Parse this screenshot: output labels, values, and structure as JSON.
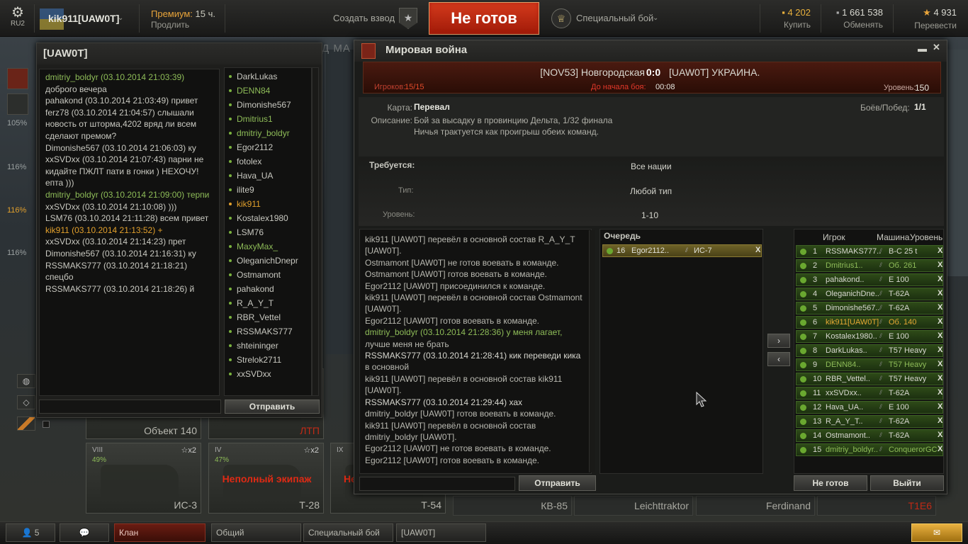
{
  "topbar": {
    "server": "RU2",
    "player_name": "kik911[UAW0T]",
    "premium_label": "Премиум:",
    "premium_days": "15 ч.",
    "extend": "Продлить",
    "create_platoon": "Создать взвод",
    "ready_button": "Не готов",
    "battle_mode": "Специальный бой",
    "gold": {
      "value": "4 202",
      "label": "Купить"
    },
    "credits": {
      "value": "1 661 538",
      "label": "Обменять"
    },
    "free_exp": {
      "value": "4 931",
      "label": "Перевести"
    }
  },
  "side": {
    "pct1": "105%",
    "pct2": "116%",
    "pct3": "116%",
    "pct4": "116%"
  },
  "hangar_tabs": "АНГАР  СКЛАД  МА",
  "chat": {
    "title": "[UAW0T]",
    "send": "Отправить",
    "messages": [
      {
        "t": "dmitriy_boldyr (03.10.2014 21:03:39)",
        "c": "green"
      },
      {
        "t": "доброго вечера",
        "c": ""
      },
      {
        "t": "pahakond (03.10.2014 21:03:49) привет",
        "c": ""
      },
      {
        "t": "ferz78 (03.10.2014 21:04:57) слышали",
        "c": ""
      },
      {
        "t": "новость от шторма,4202 вряд ли всем",
        "c": ""
      },
      {
        "t": "сделают премом?",
        "c": ""
      },
      {
        "t": "Dimonishe567 (03.10.2014 21:06:03) ку",
        "c": ""
      },
      {
        "t": "xxSVDxx (03.10.2014 21:07:43) парни не",
        "c": ""
      },
      {
        "t": "кидайте ПЖЛТ пати в гонки ) НЕХОЧУ!",
        "c": ""
      },
      {
        "t": "епта )))",
        "c": ""
      },
      {
        "t": "dmitriy_boldyr (03.10.2014 21:09:00) терпи",
        "c": "green"
      },
      {
        "t": "xxSVDxx (03.10.2014 21:10:08) )))",
        "c": ""
      },
      {
        "t": "LSM76 (03.10.2014 21:11:28) всем привет",
        "c": ""
      },
      {
        "t": "kik911 (03.10.2014 21:13:52) +",
        "c": "yellow"
      },
      {
        "t": "xxSVDxx (03.10.2014 21:14:23) прет",
        "c": ""
      },
      {
        "t": "Dimonishe567 (03.10.2014 21:16:31) ку",
        "c": ""
      },
      {
        "t": "RSSMAKS777 (03.10.2014 21:18:21) спецбо",
        "c": ""
      },
      {
        "t": "RSSMAKS777 (03.10.2014 21:18:26) й",
        "c": ""
      }
    ],
    "members": [
      {
        "n": "DarkLukas",
        "c": ""
      },
      {
        "n": "DENN84",
        "c": "g"
      },
      {
        "n": "Dimonishe567",
        "c": ""
      },
      {
        "n": "Dmitrius1",
        "c": "g"
      },
      {
        "n": "dmitriy_boldyr",
        "c": "g"
      },
      {
        "n": "Egor2112",
        "c": ""
      },
      {
        "n": "fotolex",
        "c": ""
      },
      {
        "n": "Hava_UA",
        "c": ""
      },
      {
        "n": "ilite9",
        "c": ""
      },
      {
        "n": "kik911",
        "c": "y"
      },
      {
        "n": "Kostalex1980",
        "c": ""
      },
      {
        "n": "LSM76",
        "c": ""
      },
      {
        "n": "MaxyMax_",
        "c": "g"
      },
      {
        "n": "OleganichDnepr",
        "c": ""
      },
      {
        "n": "Ostmamont",
        "c": ""
      },
      {
        "n": "pahakond",
        "c": ""
      },
      {
        "n": "R_A_Y_T",
        "c": ""
      },
      {
        "n": "RBR_Vettel",
        "c": ""
      },
      {
        "n": "RSSMAKS777",
        "c": ""
      },
      {
        "n": "shteininger",
        "c": ""
      },
      {
        "n": "Strelok2711",
        "c": ""
      },
      {
        "n": "xxSVDxx",
        "c": ""
      }
    ]
  },
  "tanks": [
    {
      "name": "Объект 140",
      "level": "",
      "count": "",
      "warn": "",
      "red": false
    },
    {
      "name": "ЛТП",
      "level": "",
      "count": "",
      "warn": "",
      "red": true
    },
    {
      "name": "ИС-3",
      "level": "VIII",
      "count": "☆x2",
      "warn": "",
      "red": false
    },
    {
      "name": "Т-28",
      "level": "IV",
      "count": "☆x2",
      "warn": "Неполный экипаж",
      "red": false
    },
    {
      "name": "Т-54",
      "level": "IX",
      "count": "",
      "warn": "Не",
      "red": false
    },
    {
      "name": "КВ-85",
      "level": "",
      "count": "",
      "warn": "",
      "red": false
    },
    {
      "name": "Leichttraktor",
      "level": "",
      "count": "",
      "warn": "",
      "red": false
    },
    {
      "name": "Ferdinand",
      "level": "",
      "count": "",
      "warn": "",
      "red": false
    },
    {
      "name": "T1E6",
      "level": "",
      "count": "",
      "warn": "",
      "red": true
    }
  ],
  "tank_pct": {
    "a": "49%",
    "b": "47%"
  },
  "battle": {
    "title": "Мировая война",
    "team_left": "[NOV53] Новгородская",
    "score": "0:0",
    "team_right": "[UAW0T] УКРАИНА.",
    "players_label": "Игроков:",
    "players_value": "15/15",
    "start_label": "До начала боя:",
    "start_value": "00:08",
    "level_label": "Уровень:",
    "level_value": "150",
    "map_label": "Карта:",
    "map_value": "Перевал",
    "desc_label": "Описание:",
    "desc_line1": "Бой за высадку в провинцию Дельта, 1/32 финала",
    "desc_line2": "Ничья трактуется как проигрыш обеих команд.",
    "wins_label": "Боёв/Побед:",
    "wins_value": "1/1",
    "req_label": "Требуется:",
    "req_value": "Все нации",
    "type_label": "Тип:",
    "type_value": "Любой тип",
    "lvl_label": "Уровень:",
    "lvl_value": "1-10",
    "log": [
      {
        "t": "kik911 [UAW0T] перевёл в основной состав R_A_Y_T",
        "c": ""
      },
      {
        "t": "[UAW0T].",
        "c": ""
      },
      {
        "t": "Ostmamont [UAW0T] не готов воевать в команде.",
        "c": ""
      },
      {
        "t": "Ostmamont [UAW0T] готов воевать в команде.",
        "c": ""
      },
      {
        "t": "Egor2112 [UAW0T] присоединился к команде.",
        "c": ""
      },
      {
        "t": "kik911 [UAW0T] перевёл в основной состав Ostmamont",
        "c": ""
      },
      {
        "t": "[UAW0T].",
        "c": ""
      },
      {
        "t": "Egor2112 [UAW0T] готов воевать в команде.",
        "c": ""
      },
      {
        "t": "dmitriy_boldyr (03.10.2014 21:28:36) у меня лагает,",
        "c": "g"
      },
      {
        "t": "лучше меня не брать",
        "c": ""
      },
      {
        "t": "RSSMAKS777 (03.10.2014 21:28:41) кик переведи кика",
        "c": "w"
      },
      {
        "t": "в основной",
        "c": ""
      },
      {
        "t": "kik911 [UAW0T] перевёл в основной состав kik911",
        "c": ""
      },
      {
        "t": "[UAW0T].",
        "c": ""
      },
      {
        "t": "RSSMAKS777 (03.10.2014 21:29:44) хах",
        "c": "w"
      },
      {
        "t": "dmitriy_boldyr [UAW0T] готов воевать в команде.",
        "c": ""
      },
      {
        "t": "kik911 [UAW0T] перевёл в основной состав",
        "c": ""
      },
      {
        "t": "dmitriy_boldyr [UAW0T].",
        "c": ""
      },
      {
        "t": "Egor2112 [UAW0T] не готов воевать в команде.",
        "c": ""
      },
      {
        "t": "Egor2112 [UAW0T] готов воевать в команде.",
        "c": ""
      }
    ],
    "send": "Отправить",
    "queue_title": "Очередь",
    "queue_item": {
      "num": "16",
      "player": "Egor2112..",
      "tank": "ИС-7",
      "x": "X"
    },
    "roster_headers": {
      "player": "Игрок",
      "tank": "Машина",
      "level": "Уровень"
    },
    "roster": [
      {
        "n": "1",
        "p": "RSSMAKS777..",
        "t": "В-С 25 t",
        "c": ""
      },
      {
        "n": "2",
        "p": "Dmitrius1..",
        "t": "Об. 261",
        "c": "green"
      },
      {
        "n": "3",
        "p": "pahakond..",
        "t": "E 100",
        "c": ""
      },
      {
        "n": "4",
        "p": "OleganichDne..",
        "t": "T-62A",
        "c": ""
      },
      {
        "n": "5",
        "p": "Dimonishe567..",
        "t": "T-62A",
        "c": ""
      },
      {
        "n": "6",
        "p": "kik911[UAW0T]",
        "t": "Об. 140",
        "c": "yellow"
      },
      {
        "n": "7",
        "p": "Kostalex1980..",
        "t": "E 100",
        "c": ""
      },
      {
        "n": "8",
        "p": "DarkLukas..",
        "t": "T57 Heavy",
        "c": ""
      },
      {
        "n": "9",
        "p": "DENN84..",
        "t": "T57 Heavy",
        "c": "green"
      },
      {
        "n": "10",
        "p": "RBR_Vettel..",
        "t": "T57 Heavy",
        "c": ""
      },
      {
        "n": "11",
        "p": "xxSVDxx..",
        "t": "T-62A",
        "c": ""
      },
      {
        "n": "12",
        "p": "Hava_UA..",
        "t": "E 100",
        "c": ""
      },
      {
        "n": "13",
        "p": "R_A_Y_T..",
        "t": "T-62A",
        "c": ""
      },
      {
        "n": "14",
        "p": "Ostmamont..",
        "t": "T-62A",
        "c": ""
      },
      {
        "n": "15",
        "p": "dmitriy_boldyr..",
        "t": "ConquerorGC",
        "c": "green"
      }
    ],
    "not_ready": "Не готов",
    "exit": "Выйти"
  },
  "bottombar": {
    "online": "5",
    "clan": "Клан",
    "common": "Общий",
    "special": "Специальный бой",
    "uawot": "[UAW0T]"
  }
}
